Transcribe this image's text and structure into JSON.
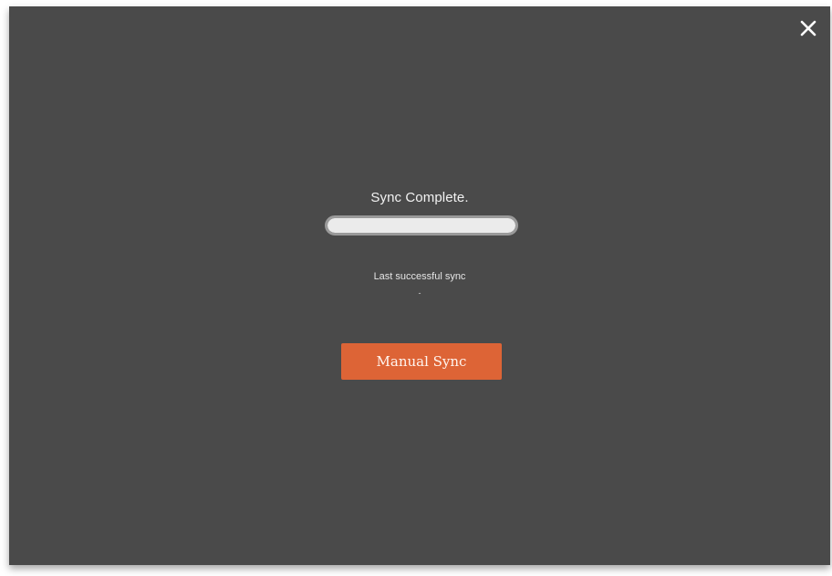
{
  "dialog": {
    "status_text": "Sync Complete.",
    "progress": 1.0,
    "last_sync_label": "Last successful sync",
    "last_sync_value": "-",
    "manual_sync_label": "Manual Sync",
    "close_icon": "close-icon"
  },
  "colors": {
    "overlay_bg": "#4a4a4a",
    "accent": "#dd6436",
    "progress_fill": "#ebebeb",
    "progress_border": "#9a9a9a",
    "text": "#f2f2f2"
  }
}
